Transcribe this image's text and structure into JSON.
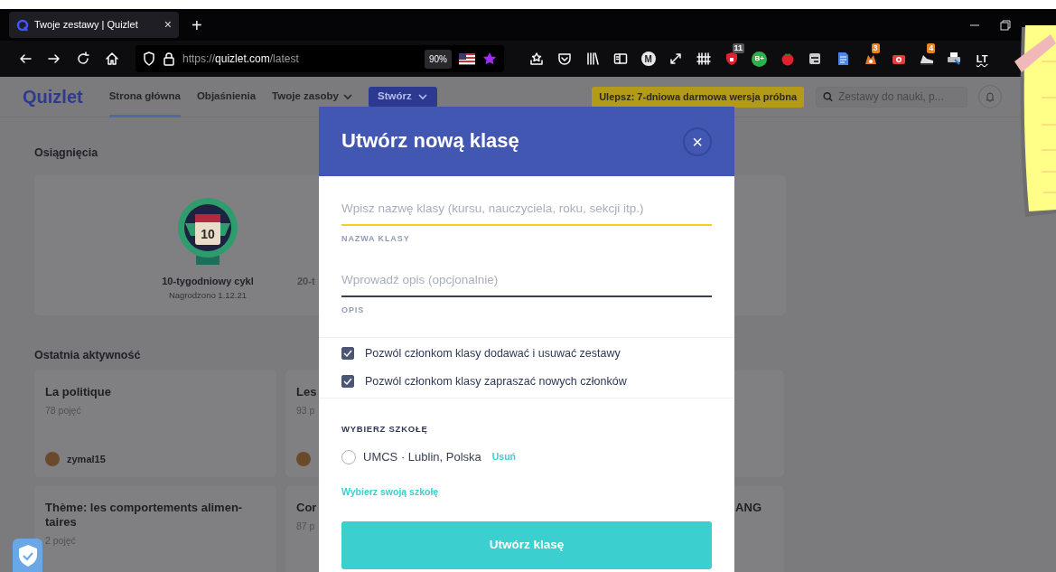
{
  "browser": {
    "tab": {
      "title": "Twoje zestawy | Quizlet",
      "close": "×",
      "selected": true
    },
    "new_tab": "+",
    "url": {
      "scheme": "https://",
      "host": "quizlet.com",
      "path": "/latest"
    },
    "zoom": "90%",
    "extensions": [
      {
        "kind": "star-tray"
      },
      {
        "kind": "pocket"
      },
      {
        "kind": "library"
      },
      {
        "kind": "reader"
      },
      {
        "kind": "letter",
        "text": "M"
      },
      {
        "kind": "expand"
      },
      {
        "kind": "fence"
      },
      {
        "kind": "shield",
        "badge": "11"
      },
      {
        "kind": "circle-letter",
        "text": "B+"
      },
      {
        "kind": "tomato"
      },
      {
        "kind": "card"
      },
      {
        "kind": "document"
      },
      {
        "kind": "fox",
        "badge": "3"
      },
      {
        "kind": "camera"
      },
      {
        "kind": "shoe",
        "badge": "4"
      },
      {
        "kind": "printer"
      },
      {
        "kind": "plain-letter",
        "text": "LT"
      }
    ]
  },
  "navbar": {
    "logo": "Quizlet",
    "links": [
      {
        "label": "Strona główna",
        "selected": true,
        "dropdown": false
      },
      {
        "label": "Objaśnienia",
        "selected": false,
        "dropdown": false
      },
      {
        "label": "Twoje zasoby",
        "selected": false,
        "dropdown": true
      }
    ],
    "create": "Stwórz",
    "upgrade": "Ulepsz: 7-dniowa darmowa wersja próbna",
    "search": {
      "placeholder": "Zestawy do nauki, p..."
    }
  },
  "achievements": {
    "title": "Osiągnięcia",
    "items": [
      {
        "name": "10-tygodniowy cykl",
        "date": "Nagrodzono 1.12.21",
        "badge": "10",
        "earned": true
      },
      {
        "name": "20-t",
        "earned": false
      }
    ]
  },
  "activity": {
    "title": "Ostatnia aktywność",
    "sets": [
      {
        "kind": "set",
        "title": "La politique",
        "count": "78 pojęć",
        "avatar": true,
        "author": "zymal15"
      },
      {
        "kind": "set",
        "title": "Les",
        "count": "93 p",
        "avatar": true
      },
      {
        "kind": "empty"
      },
      {
        "kind": "set",
        "title": "Thème: les comportements alimen-taires",
        "count": "2 pojęć"
      },
      {
        "kind": "set",
        "title": "Cor",
        "count": "87 p"
      },
      {
        "kind": "set",
        "title": "ANG"
      }
    ]
  },
  "modal": {
    "title": "Utwórz nową klasę",
    "close": "×",
    "fields": [
      {
        "placeholder": "Wpisz nazwę klasy (kursu, nauczyciela, roku, sekcji itp.)",
        "label": "NAZWA KLASY",
        "focused": true
      },
      {
        "placeholder": "Wprowadź opis (opcjonalnie)",
        "label": "OPIS",
        "focused": false
      }
    ],
    "checkboxes": [
      {
        "label": "Pozwól członkom klasy dodawać i usuwać zestawy",
        "checked": true
      },
      {
        "label": "Pozwól członkom klasy zapraszać nowych członków",
        "checked": true
      }
    ],
    "school": {
      "heading": "WYBIERZ SZKOŁĘ",
      "options": [
        {
          "label": "UMCS · Lublin, Polska",
          "selected": false,
          "action": "Usuń"
        }
      ],
      "link": "Wybierz swoją szkołę"
    },
    "submit": "Utwórz klasę"
  }
}
